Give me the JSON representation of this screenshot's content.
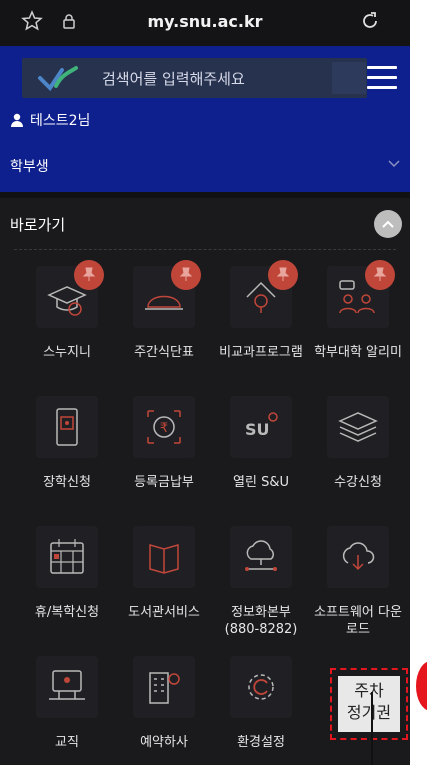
{
  "browser": {
    "url": "my.snu.ac.kr"
  },
  "header": {
    "search_placeholder": "검색어를 입력해주세요",
    "user_name": "테스트2님",
    "user_type": "학부생"
  },
  "quick_links": {
    "title": "바로가기",
    "tiles": [
      {
        "label": "스누지니",
        "icon": "graduate-icon",
        "pinned": true
      },
      {
        "label": "주간식단표",
        "icon": "cloche-icon",
        "pinned": true
      },
      {
        "label": "비교과프로그램",
        "icon": "program-icon",
        "pinned": true
      },
      {
        "label": "학부대학 알리미",
        "icon": "people-icon",
        "pinned": true
      },
      {
        "label": "장학신청",
        "icon": "scholarship-icon",
        "pinned": false
      },
      {
        "label": "등록금납부",
        "icon": "tuition-icon",
        "pinned": false
      },
      {
        "label": "열린 S&U",
        "icon": "open-snu-icon",
        "pinned": false
      },
      {
        "label": "수강신청",
        "icon": "layers-icon",
        "pinned": false
      },
      {
        "label": "휴/복학신청",
        "icon": "calendar-icon",
        "pinned": false
      },
      {
        "label": "도서관서비스",
        "icon": "book-icon",
        "pinned": false
      },
      {
        "label": "정보화본부",
        "label2": "(880-8282)",
        "icon": "cloud-network-icon",
        "pinned": false
      },
      {
        "label": "소프트웨어 다운",
        "label2": "로드",
        "icon": "cloud-download-icon",
        "pinned": false
      },
      {
        "label": "교직",
        "icon": "teaching-icon",
        "pinned": false
      },
      {
        "label": "예약하사",
        "icon": "building-icon",
        "pinned": false
      },
      {
        "label": "환경설정",
        "icon": "settings-icon",
        "pinned": false
      }
    ],
    "parking": {
      "line1": "주차",
      "line2": "정기권"
    }
  },
  "colors": {
    "header_bg": "#0e1f8e",
    "page_bg": "#1a1a1c",
    "pin": "#c0463a",
    "highlight": "#e5161d"
  }
}
